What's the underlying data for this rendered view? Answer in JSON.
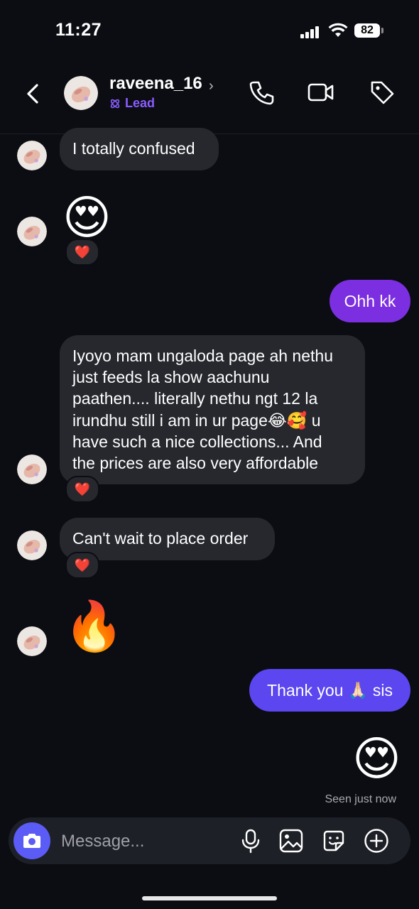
{
  "status_bar": {
    "time": "11:27",
    "battery": "82"
  },
  "header": {
    "username": "raveena_16",
    "label": "Lead",
    "icons": [
      "back-icon",
      "phone-icon",
      "video-camera-icon",
      "tag-icon"
    ]
  },
  "messages": [
    {
      "from": "them",
      "text": "I totally confused"
    },
    {
      "from": "them",
      "emoji": "😍",
      "reaction": "❤️"
    },
    {
      "from": "me",
      "text": "Ohh kk"
    },
    {
      "from": "them",
      "lines": [
        "Iyoyo mam ungaloda page ah nethu",
        "just feeds la show aachunu",
        "paathen.... literally nethu ngt 12 la",
        "irundhu still i am in ur page😂🥰 u",
        "have such a nice collections... And",
        "the prices are also very affordable"
      ],
      "reaction": "❤️"
    },
    {
      "from": "them",
      "text": "Can't wait to place order",
      "reaction": "❤️"
    },
    {
      "from": "them",
      "emoji": "🔥"
    },
    {
      "from": "me",
      "text": "Thank you 🙏🏻 sis"
    },
    {
      "from": "me",
      "emoji": "😍"
    }
  ],
  "seen_text": "Seen just now",
  "composer": {
    "placeholder": "Message...",
    "icons": [
      "camera-icon",
      "microphone-icon",
      "gallery-icon",
      "sticker-icon",
      "plus-icon"
    ]
  },
  "colors": {
    "background": "#0b0d12",
    "incoming_bubble": "#26282e",
    "outgoing_purple": "#7b2fe0",
    "outgoing_violet": "#5b46f0",
    "lead_accent": "#8a5cff",
    "camera_button": "#5b5bf5"
  }
}
